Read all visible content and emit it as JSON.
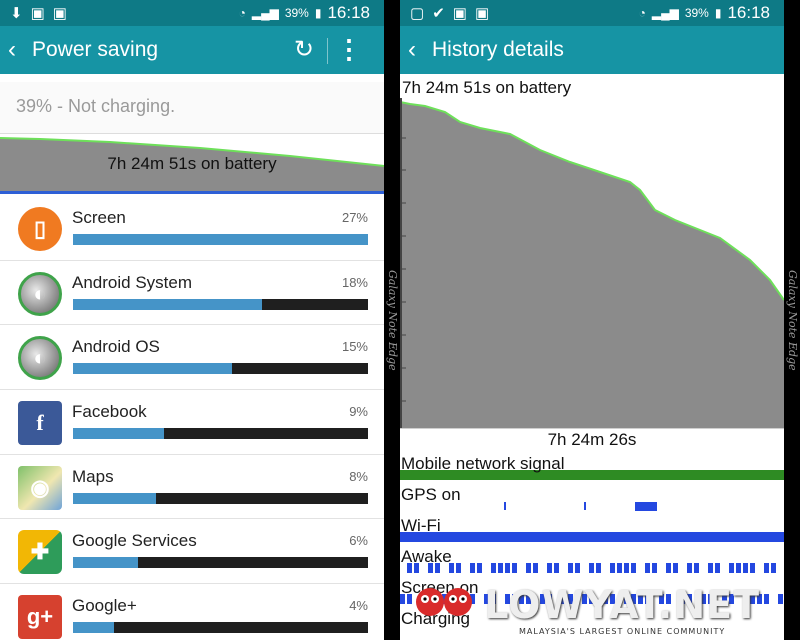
{
  "status_bar": {
    "battery_pct": "39%",
    "time": "16:18"
  },
  "left": {
    "title": "Power saving",
    "battery_status": "39% - Not charging.",
    "graph_label": "7h 24m 51s on battery",
    "items": [
      {
        "name": "Screen",
        "pct": "27%",
        "fill": 1.0,
        "icon": "screen-icon"
      },
      {
        "name": "Android System",
        "pct": "18%",
        "fill": 0.64,
        "icon": "android-system-icon"
      },
      {
        "name": "Android OS",
        "pct": "15%",
        "fill": 0.54,
        "icon": "android-os-icon"
      },
      {
        "name": "Facebook",
        "pct": "9%",
        "fill": 0.31,
        "icon": "facebook-icon"
      },
      {
        "name": "Maps",
        "pct": "8%",
        "fill": 0.28,
        "icon": "maps-icon"
      },
      {
        "name": "Google Services",
        "pct": "6%",
        "fill": 0.22,
        "icon": "google-services-icon"
      },
      {
        "name": "Google+",
        "pct": "4%",
        "fill": 0.14,
        "icon": "google-plus-icon"
      }
    ]
  },
  "right": {
    "title": "History details",
    "graph_title": "7h 24m 51s on battery",
    "graph_bottom": "7h 24m 26s",
    "rows": [
      {
        "label": "Mobile network signal",
        "type": "signal"
      },
      {
        "label": "GPS on",
        "type": "gps"
      },
      {
        "label": "Wi-Fi",
        "type": "wifi"
      },
      {
        "label": "Awake",
        "type": "awake"
      },
      {
        "label": "Screen on",
        "type": "screen"
      },
      {
        "label": "Charging",
        "type": "charging"
      }
    ]
  },
  "watermark": "Galaxy Note Edge",
  "logo": {
    "main": "LOWYAT.NET",
    "sub": "MALAYSIA'S LARGEST ONLINE COMMUNITY"
  },
  "colors": {
    "teal_dark": "#0e7a86",
    "teal": "#1694a4",
    "bar_fill": "#4594c8",
    "graph_fill": "#8b8b8b",
    "graph_line": "#6ee05a",
    "strip_blue": "#2448e0"
  }
}
